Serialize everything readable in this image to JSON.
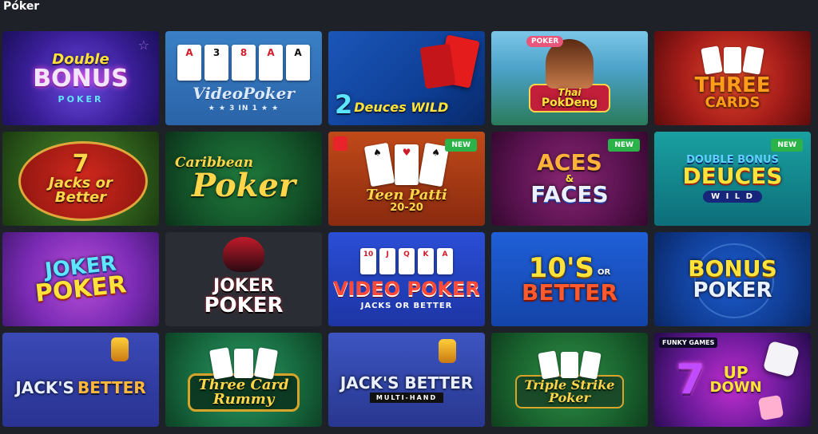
{
  "section": {
    "title": "Póker"
  },
  "badge_new": "NEW",
  "games": [
    {
      "name": "double-bonus-poker",
      "line1": "Double",
      "line2": "BONUS",
      "line3": "POKER"
    },
    {
      "name": "video-poker-3in1",
      "cards": [
        "A",
        "3",
        "8",
        "A",
        "A"
      ],
      "line1": "VideoPoker",
      "line2": "★ ★ 3 IN 1 ★ ★"
    },
    {
      "name": "2-deuces-wild",
      "line1": "2",
      "line2": "Deuces WILD"
    },
    {
      "name": "thai-pok-deng",
      "tag": "POKER",
      "line1": "Thai",
      "line2": "PokDeng"
    },
    {
      "name": "three-cards",
      "line1": "THREE",
      "line2": "CARDS"
    },
    {
      "name": "jacks-or-better",
      "line1": "7",
      "line2": "Jacks or",
      "line3": "Better"
    },
    {
      "name": "caribbean-poker",
      "line1": "Caribbean",
      "line2": "Poker"
    },
    {
      "name": "teen-patti-20-20",
      "line1": "Teen Patti",
      "line2": "20-20",
      "is_new": true
    },
    {
      "name": "aces-and-faces",
      "line1": "ACES",
      "line2": "&",
      "line3": "FACES",
      "is_new": true
    },
    {
      "name": "double-bonus-deuces-wild",
      "line1": "DOUBLE BONUS",
      "line2": "DEUCES",
      "line3": "W I L D",
      "is_new": true
    },
    {
      "name": "joker-poker-1",
      "line1": "JOKER",
      "line2": "POKER"
    },
    {
      "name": "joker-poker-2",
      "line1": "JOKER",
      "line2": "POKER"
    },
    {
      "name": "video-poker-jacks-or-better",
      "cards": [
        "10",
        "J",
        "Q",
        "K",
        "A"
      ],
      "line1": "VIDEO POKER",
      "line2": "JACKS OR BETTER"
    },
    {
      "name": "tens-or-better",
      "line1": "10'S",
      "line2": "OR",
      "line3": "BETTER"
    },
    {
      "name": "bonus-poker",
      "line1": "BONUS",
      "line2": "POKER"
    },
    {
      "name": "jacks-better-1",
      "line1": "JACK'S",
      "line2": "BETTER"
    },
    {
      "name": "three-card-rummy",
      "line1": "Three Card",
      "line2": "Rummy"
    },
    {
      "name": "jacks-better-multi-hand",
      "line1": "JACK'S BETTER",
      "line2": "MULTI-HAND"
    },
    {
      "name": "triple-strike-poker",
      "line1": "Triple Strike",
      "line2": "Poker"
    },
    {
      "name": "7-up-down",
      "provider": "FUNKY GAMES",
      "line1": "7",
      "line2": "UP",
      "line3": "DOWN"
    }
  ]
}
